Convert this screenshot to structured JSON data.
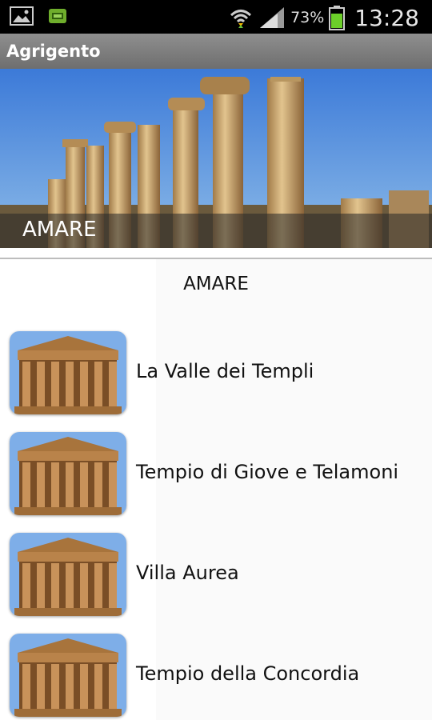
{
  "status_bar": {
    "battery_percent": "73%",
    "time": "13:28",
    "icons": [
      "gallery-icon",
      "bbm-icon",
      "wifi-icon",
      "signal-icon",
      "battery-icon"
    ]
  },
  "app_bar": {
    "title": "Agrigento"
  },
  "hero": {
    "caption": "AMARE"
  },
  "section": {
    "title": "AMARE"
  },
  "items": [
    {
      "label": "La Valle dei Templi"
    },
    {
      "label": "Tempio di Giove e Telamoni"
    },
    {
      "label": "Villa Aurea"
    },
    {
      "label": "Tempio della Concordia"
    }
  ],
  "colors": {
    "status_bar": "#000000",
    "app_bar": "#7a7a7a",
    "sky": "#3f7fd6",
    "stone": "#c9a26a"
  }
}
